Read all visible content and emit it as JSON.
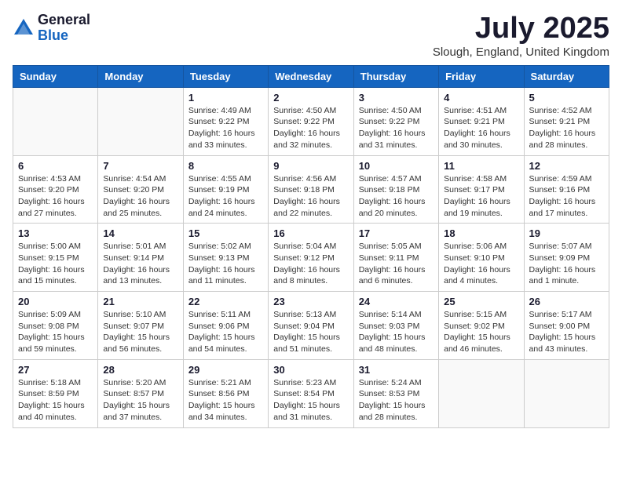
{
  "logo": {
    "general": "General",
    "blue": "Blue"
  },
  "title": "July 2025",
  "location": "Slough, England, United Kingdom",
  "days_of_week": [
    "Sunday",
    "Monday",
    "Tuesday",
    "Wednesday",
    "Thursday",
    "Friday",
    "Saturday"
  ],
  "weeks": [
    [
      {
        "day": "",
        "info": ""
      },
      {
        "day": "",
        "info": ""
      },
      {
        "day": "1",
        "info": "Sunrise: 4:49 AM\nSunset: 9:22 PM\nDaylight: 16 hours and 33 minutes."
      },
      {
        "day": "2",
        "info": "Sunrise: 4:50 AM\nSunset: 9:22 PM\nDaylight: 16 hours and 32 minutes."
      },
      {
        "day": "3",
        "info": "Sunrise: 4:50 AM\nSunset: 9:22 PM\nDaylight: 16 hours and 31 minutes."
      },
      {
        "day": "4",
        "info": "Sunrise: 4:51 AM\nSunset: 9:21 PM\nDaylight: 16 hours and 30 minutes."
      },
      {
        "day": "5",
        "info": "Sunrise: 4:52 AM\nSunset: 9:21 PM\nDaylight: 16 hours and 28 minutes."
      }
    ],
    [
      {
        "day": "6",
        "info": "Sunrise: 4:53 AM\nSunset: 9:20 PM\nDaylight: 16 hours and 27 minutes."
      },
      {
        "day": "7",
        "info": "Sunrise: 4:54 AM\nSunset: 9:20 PM\nDaylight: 16 hours and 25 minutes."
      },
      {
        "day": "8",
        "info": "Sunrise: 4:55 AM\nSunset: 9:19 PM\nDaylight: 16 hours and 24 minutes."
      },
      {
        "day": "9",
        "info": "Sunrise: 4:56 AM\nSunset: 9:18 PM\nDaylight: 16 hours and 22 minutes."
      },
      {
        "day": "10",
        "info": "Sunrise: 4:57 AM\nSunset: 9:18 PM\nDaylight: 16 hours and 20 minutes."
      },
      {
        "day": "11",
        "info": "Sunrise: 4:58 AM\nSunset: 9:17 PM\nDaylight: 16 hours and 19 minutes."
      },
      {
        "day": "12",
        "info": "Sunrise: 4:59 AM\nSunset: 9:16 PM\nDaylight: 16 hours and 17 minutes."
      }
    ],
    [
      {
        "day": "13",
        "info": "Sunrise: 5:00 AM\nSunset: 9:15 PM\nDaylight: 16 hours and 15 minutes."
      },
      {
        "day": "14",
        "info": "Sunrise: 5:01 AM\nSunset: 9:14 PM\nDaylight: 16 hours and 13 minutes."
      },
      {
        "day": "15",
        "info": "Sunrise: 5:02 AM\nSunset: 9:13 PM\nDaylight: 16 hours and 11 minutes."
      },
      {
        "day": "16",
        "info": "Sunrise: 5:04 AM\nSunset: 9:12 PM\nDaylight: 16 hours and 8 minutes."
      },
      {
        "day": "17",
        "info": "Sunrise: 5:05 AM\nSunset: 9:11 PM\nDaylight: 16 hours and 6 minutes."
      },
      {
        "day": "18",
        "info": "Sunrise: 5:06 AM\nSunset: 9:10 PM\nDaylight: 16 hours and 4 minutes."
      },
      {
        "day": "19",
        "info": "Sunrise: 5:07 AM\nSunset: 9:09 PM\nDaylight: 16 hours and 1 minute."
      }
    ],
    [
      {
        "day": "20",
        "info": "Sunrise: 5:09 AM\nSunset: 9:08 PM\nDaylight: 15 hours and 59 minutes."
      },
      {
        "day": "21",
        "info": "Sunrise: 5:10 AM\nSunset: 9:07 PM\nDaylight: 15 hours and 56 minutes."
      },
      {
        "day": "22",
        "info": "Sunrise: 5:11 AM\nSunset: 9:06 PM\nDaylight: 15 hours and 54 minutes."
      },
      {
        "day": "23",
        "info": "Sunrise: 5:13 AM\nSunset: 9:04 PM\nDaylight: 15 hours and 51 minutes."
      },
      {
        "day": "24",
        "info": "Sunrise: 5:14 AM\nSunset: 9:03 PM\nDaylight: 15 hours and 48 minutes."
      },
      {
        "day": "25",
        "info": "Sunrise: 5:15 AM\nSunset: 9:02 PM\nDaylight: 15 hours and 46 minutes."
      },
      {
        "day": "26",
        "info": "Sunrise: 5:17 AM\nSunset: 9:00 PM\nDaylight: 15 hours and 43 minutes."
      }
    ],
    [
      {
        "day": "27",
        "info": "Sunrise: 5:18 AM\nSunset: 8:59 PM\nDaylight: 15 hours and 40 minutes."
      },
      {
        "day": "28",
        "info": "Sunrise: 5:20 AM\nSunset: 8:57 PM\nDaylight: 15 hours and 37 minutes."
      },
      {
        "day": "29",
        "info": "Sunrise: 5:21 AM\nSunset: 8:56 PM\nDaylight: 15 hours and 34 minutes."
      },
      {
        "day": "30",
        "info": "Sunrise: 5:23 AM\nSunset: 8:54 PM\nDaylight: 15 hours and 31 minutes."
      },
      {
        "day": "31",
        "info": "Sunrise: 5:24 AM\nSunset: 8:53 PM\nDaylight: 15 hours and 28 minutes."
      },
      {
        "day": "",
        "info": ""
      },
      {
        "day": "",
        "info": ""
      }
    ]
  ]
}
